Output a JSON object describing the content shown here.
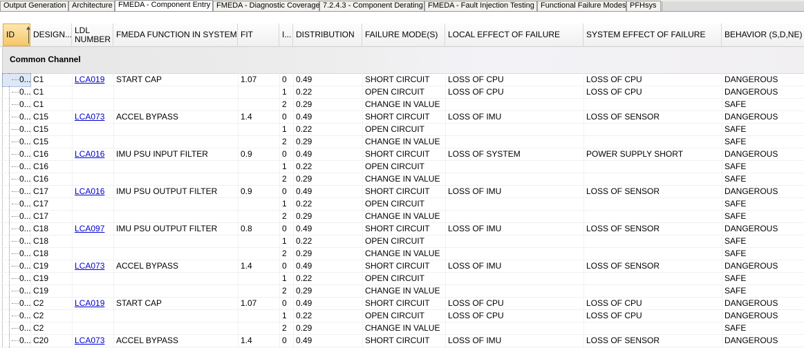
{
  "tabs": [
    {
      "label": "Output Generation",
      "active": false
    },
    {
      "label": "Architecture",
      "active": false
    },
    {
      "label": "FMEDA - Component Entry",
      "active": true
    },
    {
      "label": "FMEDA - Diagnostic Coverage",
      "active": false
    },
    {
      "label": "7.2.4.3 - Component Derating",
      "active": false
    },
    {
      "label": "FMEDA - Fault Injection Testing",
      "active": false
    },
    {
      "label": "Functional Failure Modes",
      "active": false
    },
    {
      "label": "PFHsys",
      "active": false
    }
  ],
  "columns": [
    {
      "key": "id",
      "label": "ID"
    },
    {
      "key": "designator",
      "label": "DESIGN..."
    },
    {
      "key": "ldl",
      "label": "LDL NUMBER"
    },
    {
      "key": "function",
      "label": "FMEDA FUNCTION IN SYSTEM"
    },
    {
      "key": "fit",
      "label": "FIT"
    },
    {
      "key": "idx",
      "label": "I..."
    },
    {
      "key": "distribution",
      "label": "DISTRIBUTION"
    },
    {
      "key": "mode",
      "label": "FAILURE MODE(S)"
    },
    {
      "key": "local",
      "label": "LOCAL EFFECT OF FAILURE"
    },
    {
      "key": "system",
      "label": "SYSTEM EFFECT OF FAILURE"
    },
    {
      "key": "behavior",
      "label": "BEHAVIOR (S,D,NE)"
    }
  ],
  "group_label": "Common Channel",
  "rows": [
    {
      "id": "0...",
      "designator": "C1",
      "ldl": "LCA019",
      "function": "START CAP",
      "fit": "1.07",
      "idx": "0",
      "distribution": "0.49",
      "mode": "SHORT CIRCUIT",
      "local": "LOSS OF CPU",
      "system": "LOSS OF CPU",
      "behavior": "DANGEROUS"
    },
    {
      "id": "0...",
      "designator": "C1",
      "ldl": "",
      "function": "",
      "fit": "",
      "idx": "1",
      "distribution": "0.22",
      "mode": "OPEN CIRCUIT",
      "local": "LOSS OF CPU",
      "system": "LOSS OF CPU",
      "behavior": "DANGEROUS"
    },
    {
      "id": "0...",
      "designator": "C1",
      "ldl": "",
      "function": "",
      "fit": "",
      "idx": "2",
      "distribution": "0.29",
      "mode": "CHANGE IN VALUE",
      "local": "",
      "system": "",
      "behavior": "SAFE"
    },
    {
      "id": "0...",
      "designator": "C15",
      "ldl": "LCA073",
      "function": "ACCEL BYPASS",
      "fit": "1.4",
      "idx": "0",
      "distribution": "0.49",
      "mode": "SHORT CIRCUIT",
      "local": "LOSS OF IMU",
      "system": "LOSS OF SENSOR",
      "behavior": "DANGEROUS"
    },
    {
      "id": "0...",
      "designator": "C15",
      "ldl": "",
      "function": "",
      "fit": "",
      "idx": "1",
      "distribution": "0.22",
      "mode": "OPEN CIRCUIT",
      "local": "",
      "system": "",
      "behavior": "SAFE"
    },
    {
      "id": "0...",
      "designator": "C15",
      "ldl": "",
      "function": "",
      "fit": "",
      "idx": "2",
      "distribution": "0.29",
      "mode": "CHANGE IN VALUE",
      "local": "",
      "system": "",
      "behavior": "SAFE"
    },
    {
      "id": "0...",
      "designator": "C16",
      "ldl": "LCA016",
      "function": "IMU PSU INPUT FILTER",
      "fit": "0.9",
      "idx": "0",
      "distribution": "0.49",
      "mode": "SHORT CIRCUIT",
      "local": "LOSS OF SYSTEM",
      "system": "POWER SUPPLY SHORT",
      "behavior": "DANGEROUS"
    },
    {
      "id": "0...",
      "designator": "C16",
      "ldl": "",
      "function": "",
      "fit": "",
      "idx": "1",
      "distribution": "0.22",
      "mode": "OPEN CIRCUIT",
      "local": "",
      "system": "",
      "behavior": "SAFE"
    },
    {
      "id": "0...",
      "designator": "C16",
      "ldl": "",
      "function": "",
      "fit": "",
      "idx": "2",
      "distribution": "0.29",
      "mode": "CHANGE IN VALUE",
      "local": "",
      "system": "",
      "behavior": "SAFE"
    },
    {
      "id": "0...",
      "designator": "C17",
      "ldl": "LCA016",
      "function": "IMU PSU OUTPUT FILTER",
      "fit": "0.9",
      "idx": "0",
      "distribution": "0.49",
      "mode": "SHORT CIRCUIT",
      "local": "LOSS OF IMU",
      "system": "LOSS OF SENSOR",
      "behavior": "DANGEROUS"
    },
    {
      "id": "0...",
      "designator": "C17",
      "ldl": "",
      "function": "",
      "fit": "",
      "idx": "1",
      "distribution": "0.22",
      "mode": "OPEN CIRCUIT",
      "local": "",
      "system": "",
      "behavior": "SAFE"
    },
    {
      "id": "0...",
      "designator": "C17",
      "ldl": "",
      "function": "",
      "fit": "",
      "idx": "2",
      "distribution": "0.29",
      "mode": "CHANGE IN VALUE",
      "local": "",
      "system": "",
      "behavior": "SAFE"
    },
    {
      "id": "0...",
      "designator": "C18",
      "ldl": "LCA097",
      "function": "IMU PSU OUTPUT FILTER",
      "fit": "0.8",
      "idx": "0",
      "distribution": "0.49",
      "mode": "SHORT CIRCUIT",
      "local": "LOSS OF IMU",
      "system": "LOSS OF SENSOR",
      "behavior": "DANGEROUS"
    },
    {
      "id": "0...",
      "designator": "C18",
      "ldl": "",
      "function": "",
      "fit": "",
      "idx": "1",
      "distribution": "0.22",
      "mode": "OPEN CIRCUIT",
      "local": "",
      "system": "",
      "behavior": "SAFE"
    },
    {
      "id": "0...",
      "designator": "C18",
      "ldl": "",
      "function": "",
      "fit": "",
      "idx": "2",
      "distribution": "0.29",
      "mode": "CHANGE IN VALUE",
      "local": "",
      "system": "",
      "behavior": "SAFE"
    },
    {
      "id": "0...",
      "designator": "C19",
      "ldl": "LCA073",
      "function": "ACCEL BYPASS",
      "fit": "1.4",
      "idx": "0",
      "distribution": "0.49",
      "mode": "SHORT CIRCUIT",
      "local": "LOSS OF IMU",
      "system": "LOSS OF SENSOR",
      "behavior": "DANGEROUS"
    },
    {
      "id": "0...",
      "designator": "C19",
      "ldl": "",
      "function": "",
      "fit": "",
      "idx": "1",
      "distribution": "0.22",
      "mode": "OPEN CIRCUIT",
      "local": "",
      "system": "",
      "behavior": "SAFE"
    },
    {
      "id": "0...",
      "designator": "C19",
      "ldl": "",
      "function": "",
      "fit": "",
      "idx": "2",
      "distribution": "0.29",
      "mode": "CHANGE IN VALUE",
      "local": "",
      "system": "",
      "behavior": "SAFE"
    },
    {
      "id": "0...",
      "designator": "C2",
      "ldl": "LCA019",
      "function": "START CAP",
      "fit": "1.07",
      "idx": "0",
      "distribution": "0.49",
      "mode": "SHORT CIRCUIT",
      "local": "LOSS OF CPU",
      "system": "LOSS OF CPU",
      "behavior": "DANGEROUS"
    },
    {
      "id": "0...",
      "designator": "C2",
      "ldl": "",
      "function": "",
      "fit": "",
      "idx": "1",
      "distribution": "0.22",
      "mode": "OPEN CIRCUIT",
      "local": "LOSS OF CPU",
      "system": "LOSS OF CPU",
      "behavior": "DANGEROUS"
    },
    {
      "id": "0...",
      "designator": "C2",
      "ldl": "",
      "function": "",
      "fit": "",
      "idx": "2",
      "distribution": "0.29",
      "mode": "CHANGE IN VALUE",
      "local": "",
      "system": "",
      "behavior": "SAFE"
    },
    {
      "id": "0...",
      "designator": "C20",
      "ldl": "LCA073",
      "function": "ACCEL BYPASS",
      "fit": "1.4",
      "idx": "0",
      "distribution": "0.49",
      "mode": "SHORT CIRCUIT",
      "local": "LOSS OF IMU",
      "system": "LOSS OF SENSOR",
      "behavior": "DANGEROUS"
    }
  ]
}
